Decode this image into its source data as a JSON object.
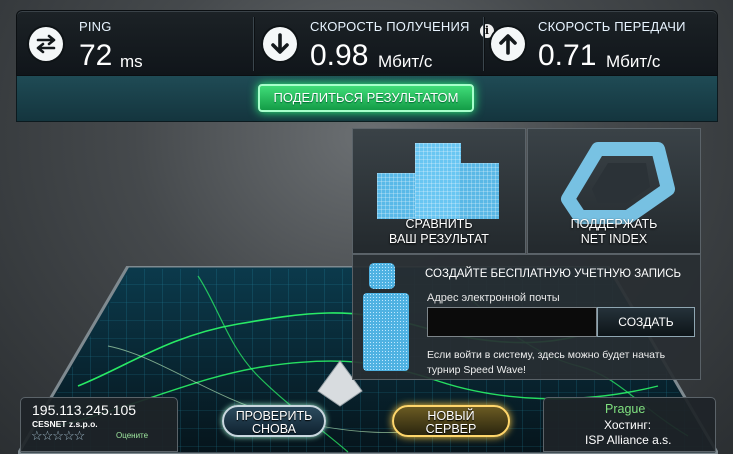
{
  "stats": {
    "ping": {
      "label": "PING",
      "value": "72",
      "unit": "ms"
    },
    "download": {
      "label": "СКОРОСТЬ ПОЛУЧЕНИЯ",
      "value": "0.98",
      "unit": "Мбит/с"
    },
    "upload": {
      "label": "СКОРОСТЬ ПЕРЕДАЧИ",
      "value": "0.71",
      "unit": "Мбит/с"
    }
  },
  "share_label": "ПОДЕЛИТЬСЯ РЕЗУЛЬТАТОМ",
  "tiles": {
    "compare": {
      "line1": "СРАВНИТЬ",
      "line2": "ВАШ РЕЗУЛЬТАТ"
    },
    "support": {
      "line1": "ПОДДЕРЖАТЬ",
      "line2": "NET INDEX"
    }
  },
  "signup": {
    "title": "СОЗДАЙТЕ БЕСПЛАТНУЮ УЧЕТНУЮ ЗАПИСЬ",
    "email_label": "Адрес электронной почты",
    "email_value": "",
    "create_label": "СОЗДАТЬ",
    "note": "Если войти в систему, здесь можно будет начать турнир Speed Wave!"
  },
  "client": {
    "ip": "195.113.245.105",
    "isp": "CESNET z.s.p.o.",
    "stars": "☆☆☆☆☆",
    "rate_label": "Оцените"
  },
  "buttons": {
    "retry": {
      "line1": "ПРОВЕРИТЬ",
      "line2": "СНОВА"
    },
    "new_server": {
      "line1": "НОВЫЙ",
      "line2": "СЕРВЕР"
    }
  },
  "server": {
    "city": "Prague",
    "host_label": "Хостинг:",
    "host_name": "ISP Alliance a.s."
  },
  "info_icon": "i",
  "colors": {
    "accent_green": "#2cff7e",
    "server_gold": "#ffd66b",
    "grid_cyan": "#29d3ff",
    "city_green": "#7fe07f"
  }
}
